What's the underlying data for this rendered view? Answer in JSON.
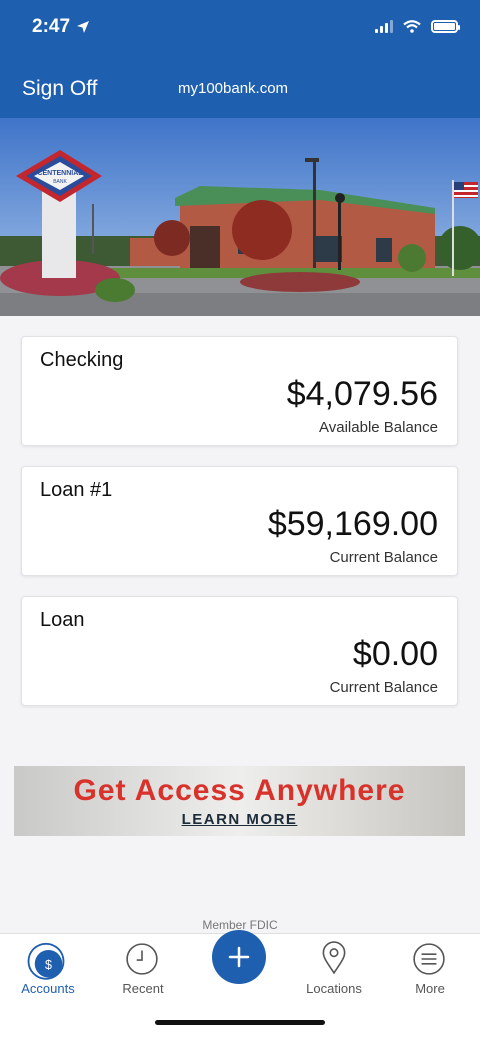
{
  "status_bar": {
    "time": "2:47"
  },
  "header": {
    "sign_off_label": "Sign Off",
    "site_url": "my100bank.com"
  },
  "hero": {
    "sign_text": "CENTENNIAL",
    "sign_subtext": "BANK"
  },
  "accounts": [
    {
      "name": "Checking",
      "amount": "$4,079.56",
      "balance_label": "Available Balance"
    },
    {
      "name": "Loan #1",
      "amount": "$59,169.00",
      "balance_label": "Current Balance"
    },
    {
      "name": "Loan",
      "amount": "$0.00",
      "balance_label": "Current Balance"
    }
  ],
  "promo": {
    "title": "Get Access Anywhere",
    "link_label": "LEARN MORE"
  },
  "footer": {
    "member_text": "Member FDIC"
  },
  "tabs": [
    {
      "label": "Accounts",
      "icon": "dollar-icon",
      "active": true
    },
    {
      "label": "Recent",
      "icon": "clock-icon",
      "active": false
    },
    {
      "label": "",
      "icon": "plus-icon",
      "active": false
    },
    {
      "label": "Locations",
      "icon": "location-pin-icon",
      "active": false
    },
    {
      "label": "More",
      "icon": "menu-icon",
      "active": false
    }
  ],
  "colors": {
    "brand_blue": "#1f5fb0",
    "promo_red": "#d9322b"
  }
}
